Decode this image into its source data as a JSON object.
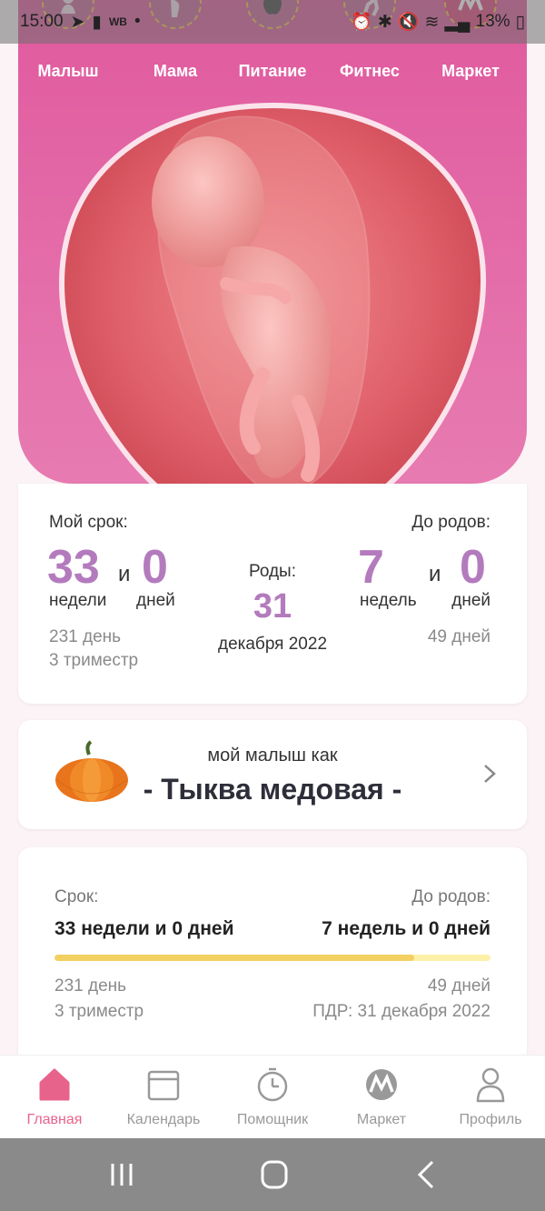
{
  "status_bar": {
    "time": "15:00",
    "carrier_badge": "WB",
    "battery": "13%"
  },
  "categories": [
    {
      "label": "Малыш",
      "icon": "baby-icon"
    },
    {
      "label": "Мама",
      "icon": "pregnant-woman-icon"
    },
    {
      "label": "Питание",
      "icon": "apple-icon"
    },
    {
      "label": "Фитнес",
      "icon": "fitness-icon"
    },
    {
      "label": "Маркет",
      "icon": "market-logo-icon"
    }
  ],
  "term": {
    "my_term_label": "Мой срок:",
    "weeks": "33",
    "and": "и",
    "days": "0",
    "weeks_unit": "недели",
    "days_unit": "дней",
    "total_days": "231 день",
    "trimester": "3 триместр",
    "birth_label": "Роды:",
    "birth_day": "31",
    "birth_month_year": "декабря 2022",
    "until_label": "До родов:",
    "until_weeks": "7",
    "until_and": "и",
    "until_days": "0",
    "until_weeks_unit": "недель",
    "until_days_unit": "дней",
    "until_total_days": "49 дней"
  },
  "baby_size": {
    "caption": "мой малыш как",
    "fruit": "- Тыква медовая -"
  },
  "progress": {
    "term_label": "Срок:",
    "term_value": "33 недели и 0 дней",
    "until_label": "До родов:",
    "until_value": "7 недель и 0 дней",
    "fraction": 0.825,
    "total_days": "231 день",
    "trimester": "3 триместр",
    "until_total_days": "49 дней",
    "due_date": "ПДР: 31 декабря 2022"
  },
  "bottom_nav": [
    {
      "label": "Главная",
      "icon": "home-icon",
      "active": true
    },
    {
      "label": "Календарь",
      "icon": "calendar-icon",
      "active": false
    },
    {
      "label": "Помощник",
      "icon": "timer-icon",
      "active": false
    },
    {
      "label": "Маркет",
      "icon": "market-logo-icon",
      "active": false
    },
    {
      "label": "Профиль",
      "icon": "profile-icon",
      "active": false
    }
  ],
  "colors": {
    "accent_pink": "#e05a9e",
    "number_purple": "#b37bbd",
    "active_nav": "#e8638c",
    "progress_fill": "#f2d062"
  }
}
